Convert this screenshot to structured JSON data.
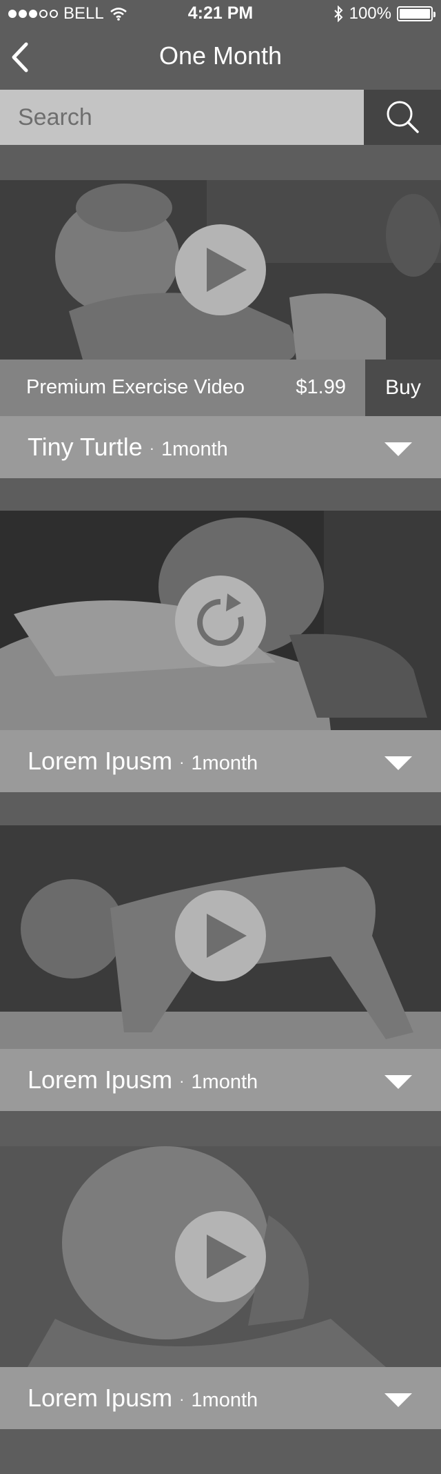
{
  "status_bar": {
    "carrier": "BELL",
    "time": "4:21 PM",
    "battery": "100%"
  },
  "nav": {
    "title": "One Month"
  },
  "search": {
    "placeholder": "Search"
  },
  "cards": [
    {
      "title": "Tiny Turtle",
      "separator": "·",
      "meta": "1month",
      "control": "play",
      "buy": {
        "label": "Premium Exercise Video",
        "price": "$1.99",
        "button": "Buy"
      }
    },
    {
      "title": "Lorem Ipusm",
      "separator": "·",
      "meta": "1month",
      "control": "replay"
    },
    {
      "title": "Lorem Ipusm",
      "separator": "·",
      "meta": "1month",
      "control": "play"
    },
    {
      "title": "Lorem Ipusm",
      "separator": "·",
      "meta": "1month",
      "control": "play"
    }
  ],
  "colors": {
    "background": "#5d5d5d",
    "search_field": "#c4c4c4",
    "search_button": "#444444",
    "title_bar": "#9a9a9a",
    "buy_info": "#838383",
    "buy_button": "#4b4b4b",
    "control_circle": "#b4b4b4"
  }
}
